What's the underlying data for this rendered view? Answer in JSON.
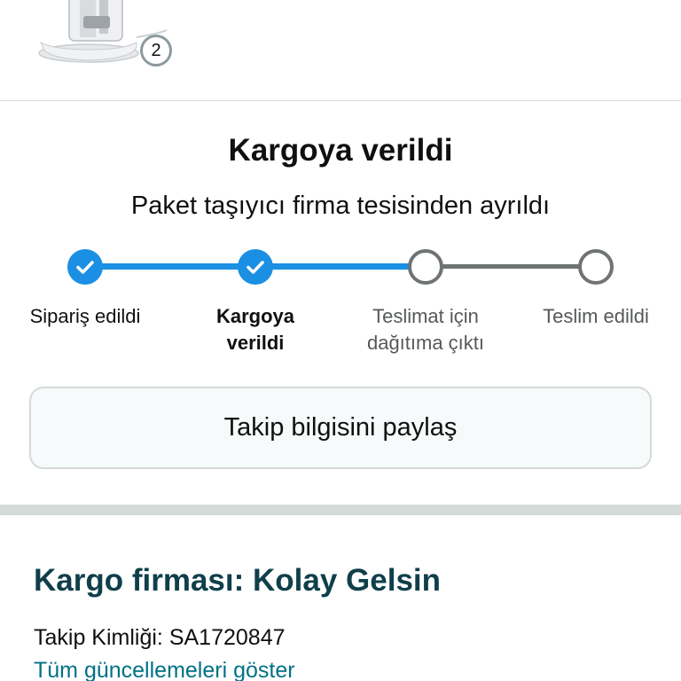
{
  "product": {
    "quantity": "2",
    "thumbnail_icon": "product-image"
  },
  "status": {
    "title": "Kargoya verildi",
    "subtitle": "Paket taşıyıcı firma tesisinden ayrıldı"
  },
  "tracker": {
    "steps": [
      {
        "label_line1": "Sipariş edildi",
        "label_line2": "",
        "state": "done"
      },
      {
        "label_line1": "Kargoya",
        "label_line2": "verildi",
        "state": "done"
      },
      {
        "label_line1": "Teslimat için",
        "label_line2": "dağıtıma çıktı",
        "state": "pending"
      },
      {
        "label_line1": "Teslim edildi",
        "label_line2": "",
        "state": "pending"
      }
    ],
    "colors": {
      "done": "#1a8fe3",
      "pending": "#6f7373"
    }
  },
  "share": {
    "label": "Takip bilgisini paylaş"
  },
  "carrier": {
    "title": "Kargo firması: Kolay Gelsin",
    "tracking_id": "Takip Kimliği: SA1720847",
    "all_updates_link": "Tüm güncellemeleri göster"
  }
}
